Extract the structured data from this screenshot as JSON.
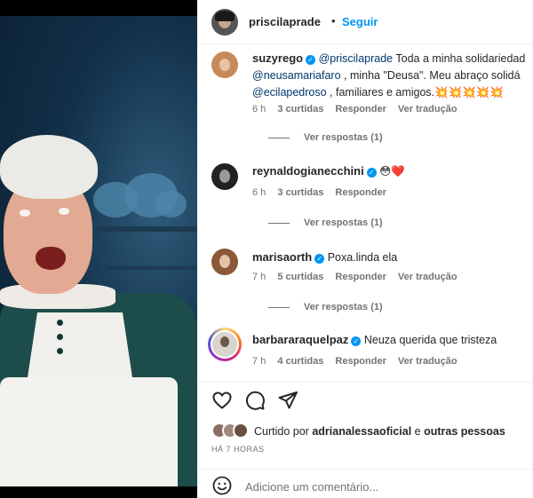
{
  "post": {
    "author": "priscilaprade",
    "separator": "•",
    "follow_label": "Seguir"
  },
  "comments": [
    {
      "user": "suzyrego",
      "verified": true,
      "mention1": "@priscilaprade",
      "text1": " Toda a minha solidariedad",
      "mention2": "@neusamariafaro",
      "text2": " , minha \"Deusa\". Meu abraço solidá",
      "mention3": "@ecilapedroso",
      "text3": " , familiares e amigos.💥💥💥💥💥",
      "time": "6 h",
      "likes": "3 curtidas",
      "reply": "Responder",
      "translate": "Ver tradução",
      "view_replies": "Ver respostas (1)"
    },
    {
      "user": "reynaldogianecchini",
      "verified": true,
      "text": "😳❤️",
      "time": "6 h",
      "likes": "3 curtidas",
      "reply": "Responder",
      "view_replies": "Ver respostas (1)"
    },
    {
      "user": "marisaorth",
      "verified": true,
      "text": "Poxa.linda ela",
      "time": "7 h",
      "likes": "5 curtidas",
      "reply": "Responder",
      "translate": "Ver tradução",
      "view_replies": "Ver respostas (1)"
    },
    {
      "user": "barbararaquelpaz",
      "verified": true,
      "text": "Neuza querida que tristeza",
      "time": "7 h",
      "likes": "4 curtidas",
      "reply": "Responder",
      "translate": "Ver tradução"
    }
  ],
  "likes_line": {
    "prefix": "Curtido por ",
    "user": "adrianalessaoficial",
    "middle": " e ",
    "others": "outras pessoas"
  },
  "timestamp": "HÁ 7 HORAS",
  "add_comment": {
    "placeholder": "Adicione um comentário..."
  },
  "icons": {
    "like": "heart-icon",
    "comment": "comment-icon",
    "share": "send-icon",
    "emoji": "emoji-icon"
  },
  "colors": {
    "link_blue": "#0095f6",
    "mention": "#00376b",
    "muted": "#737373"
  }
}
